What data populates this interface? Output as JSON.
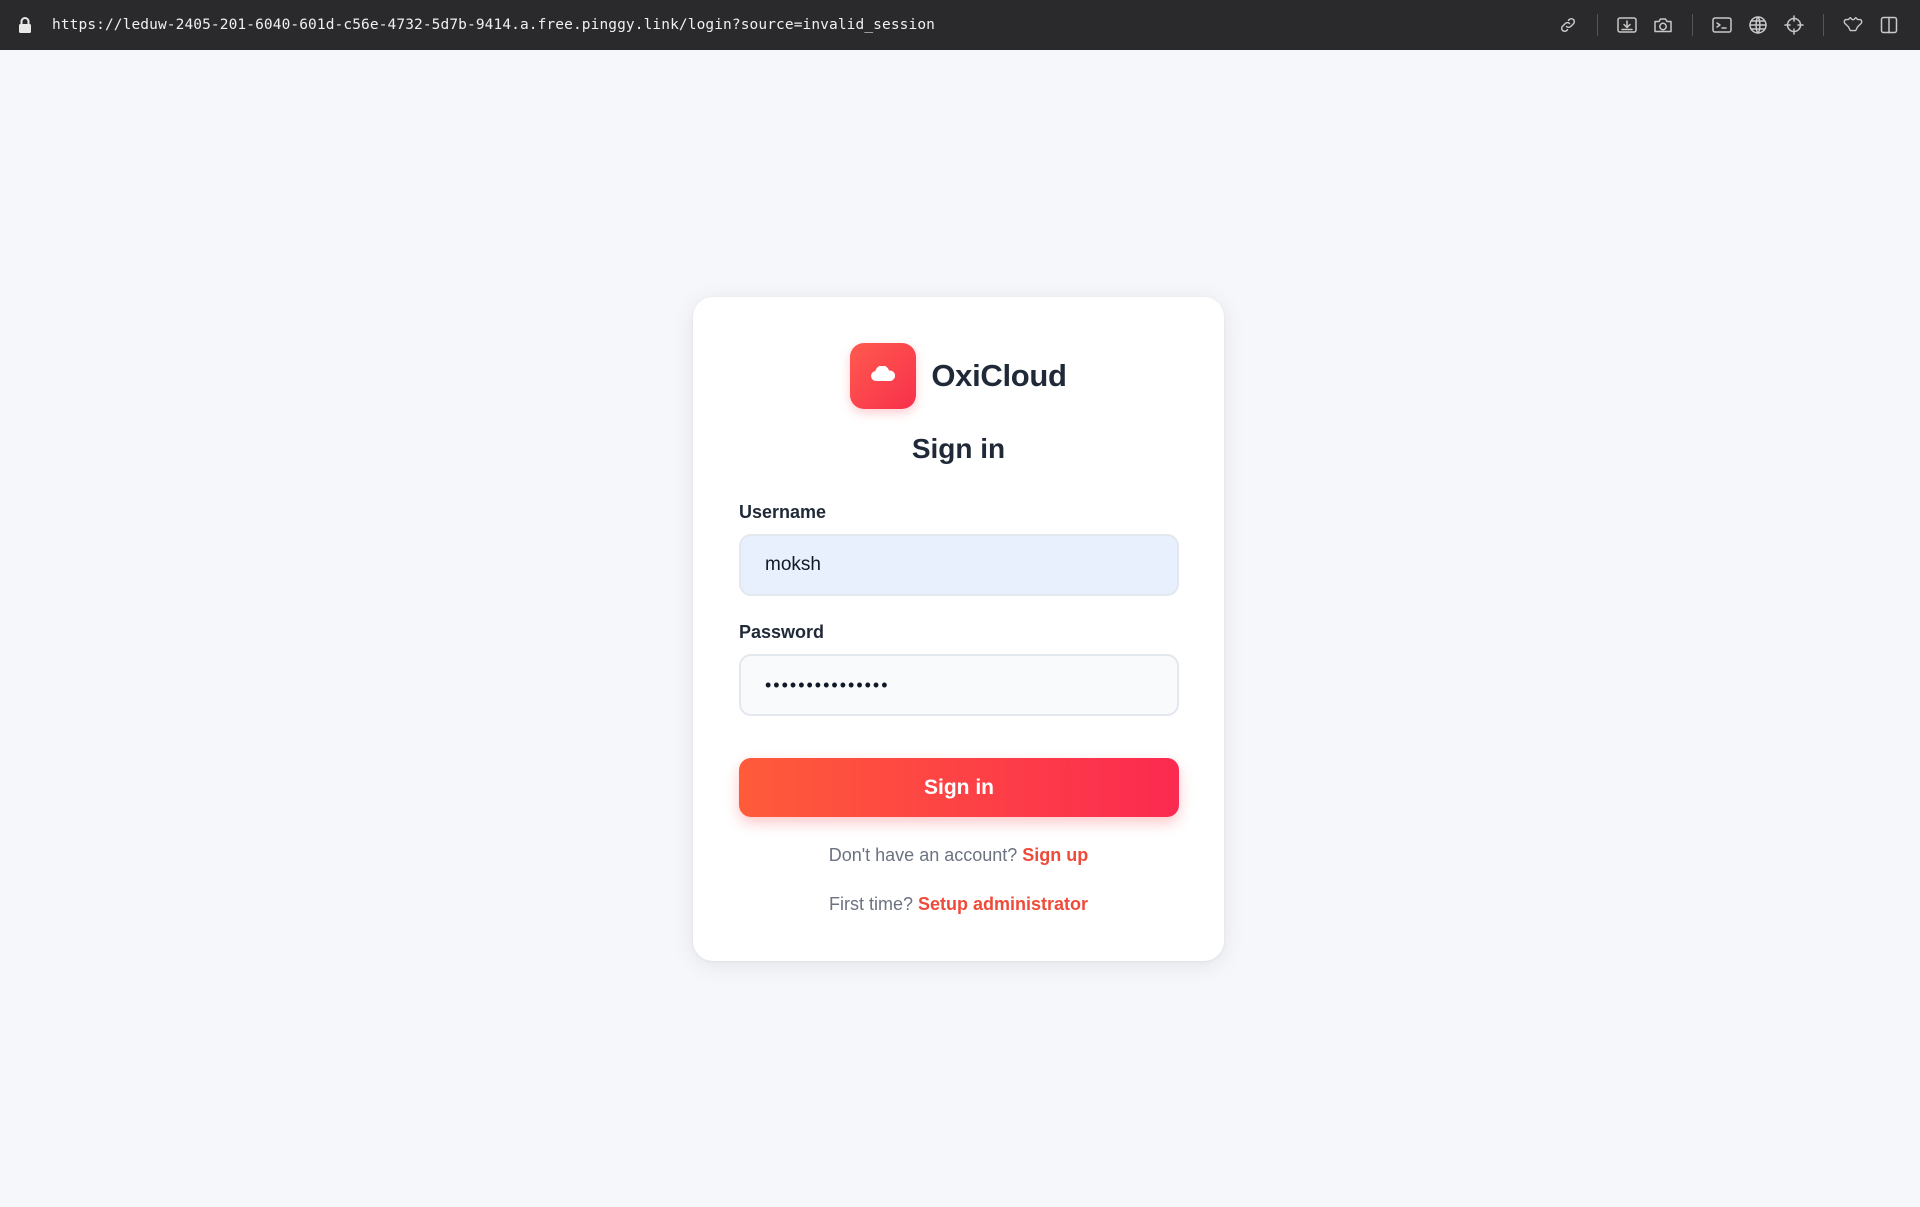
{
  "browser": {
    "url": "https://leduw-2405-201-6040-601d-c56e-4732-5d7b-9414.a.free.pinggy.link/login?source=invalid_session",
    "icons": [
      "lock-icon",
      "link-icon",
      "download-image-icon",
      "camera-icon",
      "terminal-icon",
      "globe-icon",
      "crosshair-icon",
      "extension-icon",
      "sidebar-icon"
    ]
  },
  "brand": {
    "name": "OxiCloud",
    "logo_icon": "cloud-icon",
    "accent": "#ff5a4e",
    "accent_end": "#f8304c"
  },
  "login": {
    "title": "Sign in",
    "username_label": "Username",
    "username_value": "moksh",
    "password_label": "Password",
    "password_value": "•••••••••••••••",
    "submit_label": "Sign in"
  },
  "footer": {
    "signup_prompt": "Don't have an account?",
    "signup_link": "Sign up",
    "setup_prompt": "First time?",
    "setup_link": "Setup administrator"
  }
}
